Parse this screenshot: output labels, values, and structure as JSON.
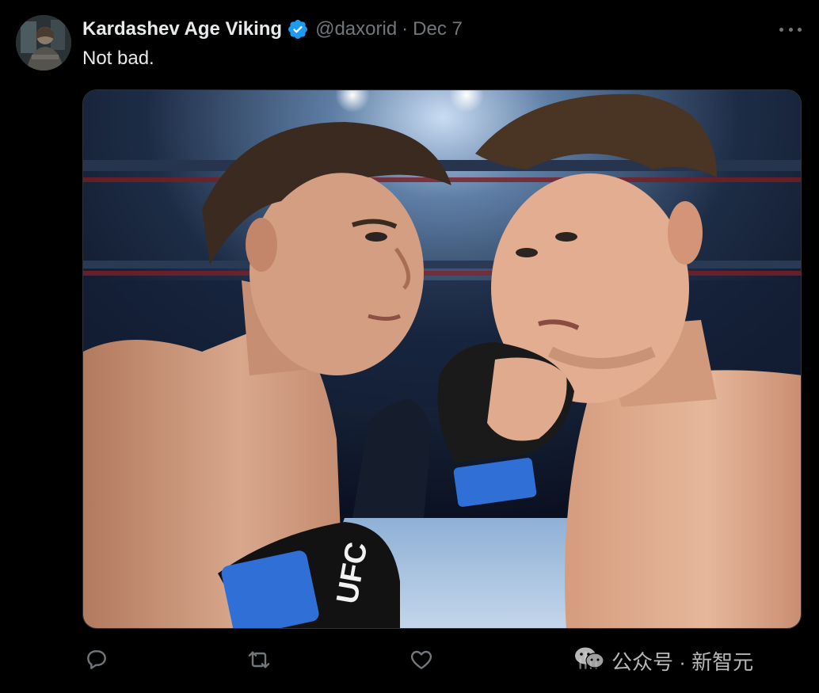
{
  "tweet": {
    "display_name": "Kardashev Age Viking",
    "handle": "@daxorid",
    "separator": "·",
    "date": "Dec 7",
    "text": "Not bad."
  },
  "media": {
    "glove_text": "UFC"
  },
  "watermark": {
    "text": "公众号 · 新智元"
  },
  "colors": {
    "background": "#000000",
    "text_primary": "#e7e9ea",
    "text_secondary": "#71767b",
    "verified_badge": "#1d9bf0"
  },
  "icons": {
    "more": "more-icon",
    "verified": "verified-badge-icon",
    "reply": "reply-icon",
    "retweet": "retweet-icon",
    "like": "heart-icon",
    "views": "views-icon"
  }
}
